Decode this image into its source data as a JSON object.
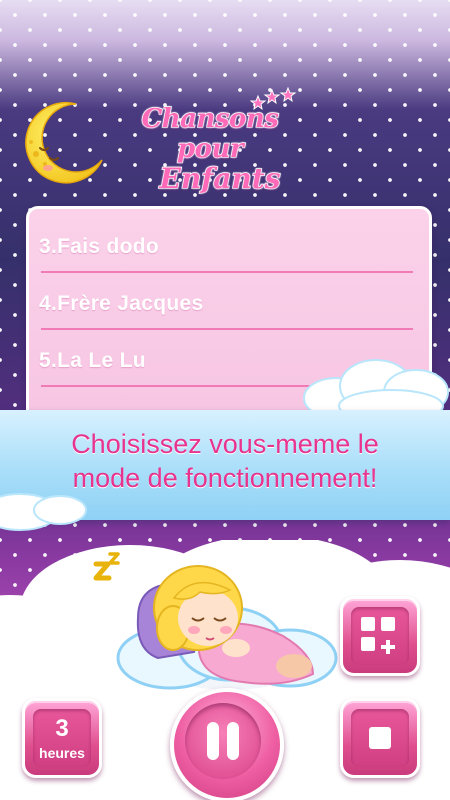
{
  "header": {
    "title_line1": "Chansons pour",
    "title_line2": "Enfants"
  },
  "playlist": {
    "items": [
      {
        "label": "3.Fais dodo"
      },
      {
        "label": "4.Frère Jacques"
      },
      {
        "label": "5.La Le Lu"
      }
    ]
  },
  "banner": {
    "line1": "Choisissez vous-meme le",
    "line2": "mode de fonctionnement!"
  },
  "controls": {
    "timer_value": "3",
    "timer_unit": "heures",
    "pause_icon": "pause-icon",
    "stop_icon": "stop-icon",
    "mode_icon": "grid-plus-icon"
  },
  "colors": {
    "accent_pink": "#e8338f",
    "panel_pink": "#fbd2ea",
    "banner_blue": "#a9def9"
  }
}
